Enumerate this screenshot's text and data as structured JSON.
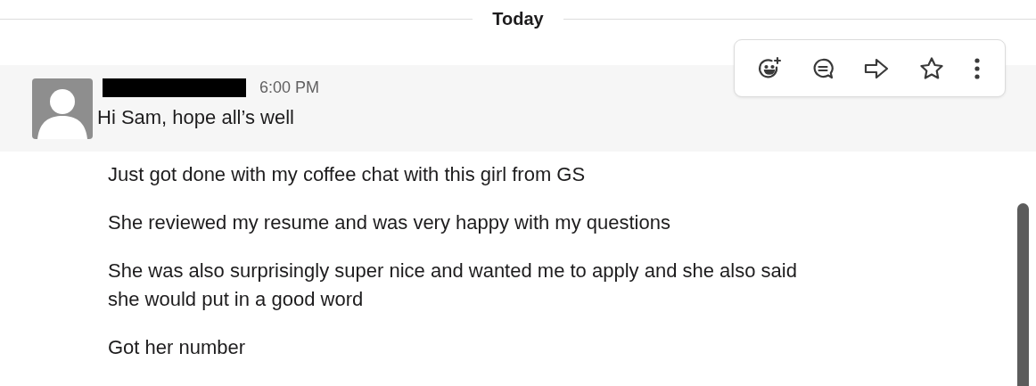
{
  "date_divider": {
    "label": "Today"
  },
  "message": {
    "highlighted": true,
    "time": "6:00 PM",
    "text": "Hi Sam, hope all’s well"
  },
  "followups": [
    "Just got done with my coffee chat with this girl from GS",
    "She reviewed my resume and was very happy with my questions",
    "She was also surprisingly super nice and wanted me to apply and she also said she would put in a good word",
    "Got her number"
  ],
  "actions": [
    {
      "kind": "reaction"
    },
    {
      "kind": "thread"
    },
    {
      "kind": "share"
    },
    {
      "kind": "save"
    },
    {
      "kind": "more"
    }
  ]
}
